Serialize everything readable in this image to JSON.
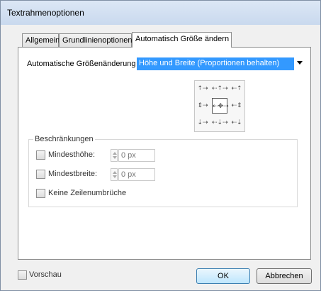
{
  "dialog": {
    "title": "Textrahmenoptionen"
  },
  "tabs": [
    {
      "label": "Allgemein",
      "active": false
    },
    {
      "label": "Grundlinienoptionen",
      "active": false
    },
    {
      "label": "Automatisch Größe ändern",
      "active": true
    }
  ],
  "auto_resize": {
    "label": "Automatische Größenänderung",
    "selected": "Höhe und Breite (Proportionen behalten)"
  },
  "reference_points": [
    {
      "icon": "top-left-anchor-icon",
      "glyph": "⇡⇢",
      "active": false
    },
    {
      "icon": "top-center-anchor-icon",
      "glyph": "⇠⇡⇢",
      "active": false
    },
    {
      "icon": "top-right-anchor-icon",
      "glyph": "⇠⇡",
      "active": false
    },
    {
      "icon": "middle-left-anchor-icon",
      "glyph": "⇕⇢",
      "active": false
    },
    {
      "icon": "center-anchor-icon",
      "glyph": "⇠✥⇢",
      "active": true
    },
    {
      "icon": "middle-right-anchor-icon",
      "glyph": "⇠⇕",
      "active": false
    },
    {
      "icon": "bottom-left-anchor-icon",
      "glyph": "⇣⇢",
      "active": false
    },
    {
      "icon": "bottom-center-anchor-icon",
      "glyph": "⇠⇣⇢",
      "active": false
    },
    {
      "icon": "bottom-right-anchor-icon",
      "glyph": "⇠⇣",
      "active": false
    }
  ],
  "constraints": {
    "title": "Beschränkungen",
    "min_height": {
      "label": "Mindesthöhe:",
      "checked": false,
      "value": "0 px"
    },
    "min_width": {
      "label": "Mindestbreite:",
      "checked": false,
      "value": "0 px"
    },
    "no_line_breaks": {
      "label": "Keine Zeilenumbrüche",
      "checked": false
    }
  },
  "footer": {
    "preview_label": "Vorschau",
    "preview_checked": false,
    "ok_label": "OK",
    "cancel_label": "Abbrechen"
  }
}
